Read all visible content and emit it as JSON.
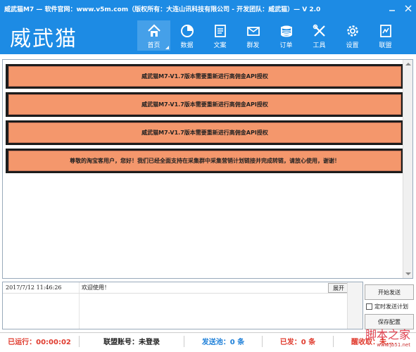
{
  "window": {
    "title": "威武猫M7 — 软件官网：www.v5m.com（版权所有：大连山讯科技有限公司 - 开发团队：威武猫）— V 2.0"
  },
  "header": {
    "logo_text": "威武猫",
    "nav": [
      {
        "label": "首页",
        "icon": "home-icon"
      },
      {
        "label": "数据",
        "icon": "pie-chart-icon"
      },
      {
        "label": "文案",
        "icon": "document-icon"
      },
      {
        "label": "群发",
        "icon": "envelope-icon"
      },
      {
        "label": "订单",
        "icon": "coins-icon"
      },
      {
        "label": "工具",
        "icon": "tools-icon"
      },
      {
        "label": "设置",
        "icon": "gear-icon"
      },
      {
        "label": "联盟",
        "icon": "alliance-icon"
      }
    ]
  },
  "notices": [
    "威武猫M7-V1.7版本需要重新进行高佣金API授权",
    "威武猫M7-V1.7版本需要重新进行高佣金API授权",
    "威武猫M7-V1.7版本需要重新进行高佣金API授权",
    "尊敬的淘宝客用户，您好！我们已经全面支持在采集群中采集营销计划链接并完成转链，请放心使用，谢谢！"
  ],
  "log": {
    "time": "2017/7/12  11:46:26",
    "message": "欢迎使用！",
    "expand_label": "展开"
  },
  "controls": {
    "start_label": "开始发送",
    "schedule_label": "定时发送计划",
    "save_label": "保存配置"
  },
  "status": {
    "running": "已运行：00:00:02",
    "account": "联盟账号：未登录",
    "pool": "发送池：0 条",
    "sent": "已发：0 条",
    "fourth": "醒收取：未…"
  },
  "watermark": {
    "big": "脚本之家",
    "small": "www.jb51.net"
  },
  "colors": {
    "brand_blue": "#1d8be4",
    "notice_bg": "#f4976c",
    "status_red": "#e03b2e",
    "status_blue": "#1d7fd8"
  }
}
